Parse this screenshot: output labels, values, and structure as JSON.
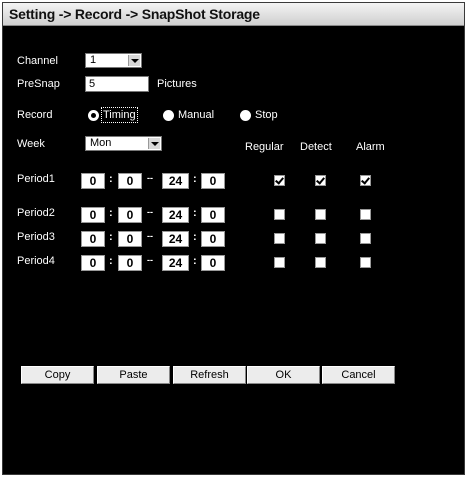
{
  "title": "Setting -> Record -> SnapShot Storage",
  "channel": {
    "label": "Channel",
    "value": "1"
  },
  "presnap": {
    "label": "PreSnap",
    "value": "5",
    "unit": "Pictures"
  },
  "record": {
    "label": "Record",
    "options": [
      "Timing",
      "Manual",
      "Stop"
    ],
    "selected": "Timing"
  },
  "week": {
    "label": "Week",
    "value": "Mon"
  },
  "columns": {
    "regular": "Regular",
    "detect": "Detect",
    "alarm": "Alarm"
  },
  "periods": [
    {
      "label": "Period1",
      "start_h": "0",
      "start_m": "0",
      "end_h": "24",
      "end_m": "0",
      "regular": true,
      "detect": true,
      "alarm": true
    },
    {
      "label": "Period2",
      "start_h": "0",
      "start_m": "0",
      "end_h": "24",
      "end_m": "0",
      "regular": false,
      "detect": false,
      "alarm": false
    },
    {
      "label": "Period3",
      "start_h": "0",
      "start_m": "0",
      "end_h": "24",
      "end_m": "0",
      "regular": false,
      "detect": false,
      "alarm": false
    },
    {
      "label": "Period4",
      "start_h": "0",
      "start_m": "0",
      "end_h": "24",
      "end_m": "0",
      "regular": false,
      "detect": false,
      "alarm": false
    }
  ],
  "time_sep": ":",
  "range_sep": "--",
  "buttons": {
    "copy": "Copy",
    "paste": "Paste",
    "refresh": "Refresh",
    "ok": "OK",
    "cancel": "Cancel"
  }
}
